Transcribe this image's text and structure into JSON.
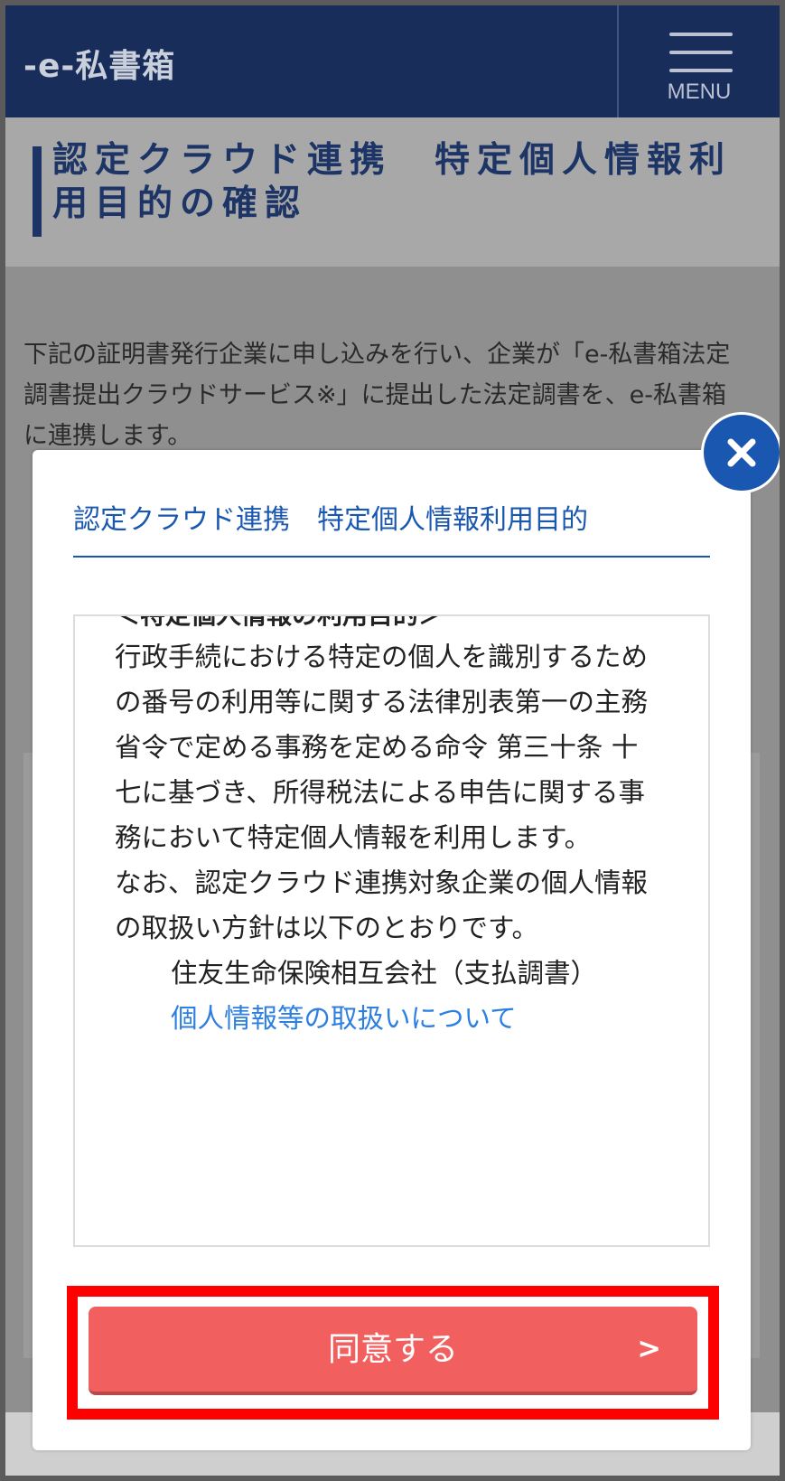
{
  "header": {
    "logo_text": "-e-私書箱",
    "menu_label": "MENU"
  },
  "page": {
    "title": "認定クラウド連携　特定個人情報利用目的の確認",
    "intro_text": "下記の証明書発行企業に申し込みを行い、企業が「e-私書箱法定調書提出クラウドサービス※」に提出した法定調書を、e-私書箱に連携します。"
  },
  "modal": {
    "heading": "認定クラウド連携　特定個人情報利用目的",
    "sub_heading": "＜特定個人情報の利用目的＞",
    "paragraph1": "行政手続における特定の個人を識別するための番号の利用等に関する法律別表第一の主務省令で定める事務を定める命令 第三十条 十七に基づき、所得税法による申告に関する事務において特定個人情報を利用します。",
    "paragraph2": "なお、認定クラウド連携対象企業の個人情報の取扱い方針は以下のとおりです。",
    "company": "住友生命保険相互会社（支払調書）",
    "policy_link": "個人情報等の取扱いについて",
    "agree_button": "同意する",
    "agree_arrow": ">",
    "close_icon": "close-icon"
  },
  "colors": {
    "header_bg": "#182d5a",
    "accent_blue": "#1a57b0",
    "link_blue": "#2d7fe0",
    "agree_button_bg": "#f25f5f",
    "highlight_outline": "#ff0000"
  }
}
